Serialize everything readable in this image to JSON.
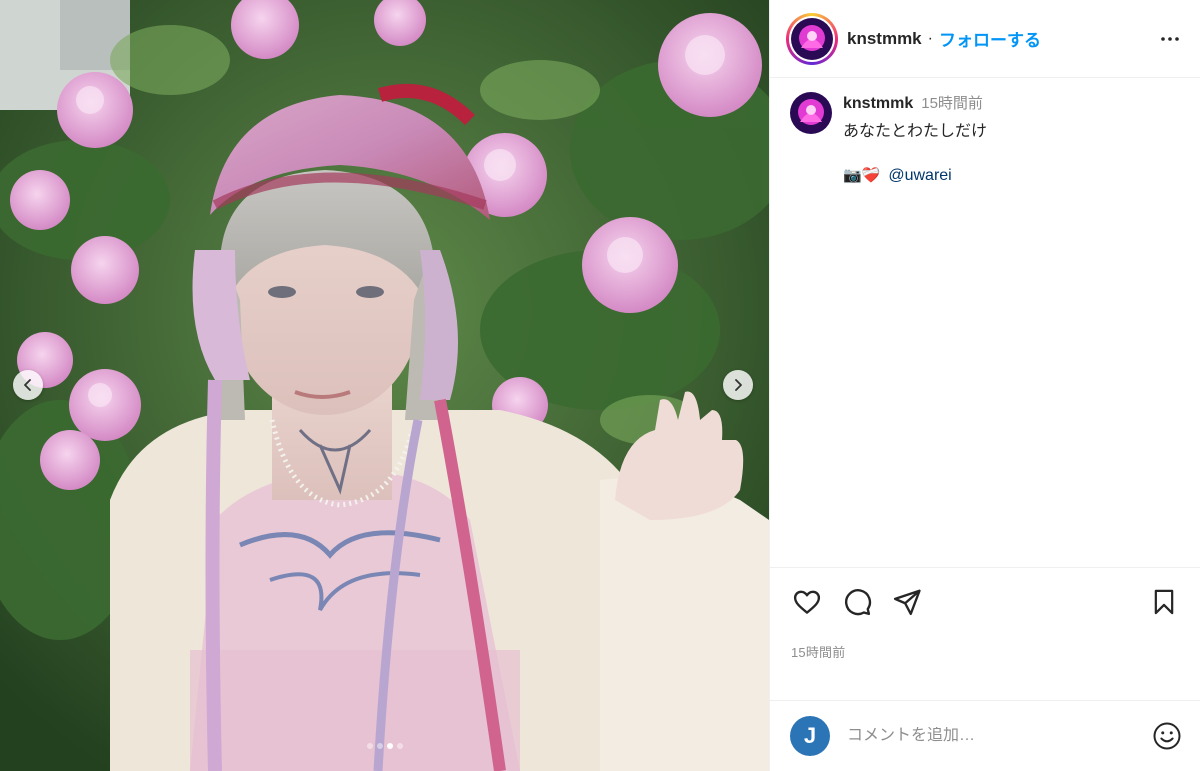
{
  "header": {
    "username": "knstmmk",
    "separator": "·",
    "follow_label": "フォローする",
    "more_icon": "more-horizontal-icon"
  },
  "caption": {
    "username": "knstmmk",
    "time": "15時間前",
    "text": "あなたとわたしだけ",
    "credit_emoji": "📷❤️‍🩹",
    "mention": "@uwarei"
  },
  "actions": {
    "like_icon": "heart-icon",
    "comment_icon": "comment-icon",
    "share_icon": "send-icon",
    "save_icon": "bookmark-icon",
    "timestamp": "15時間前"
  },
  "comment": {
    "avatar_letter": "J",
    "placeholder": "コメントを追加…",
    "emoji_icon": "smiley-icon"
  },
  "carousel": {
    "prev_icon": "chevron-left-icon",
    "next_icon": "chevron-right-icon",
    "slide_count": 4,
    "active_index": 2
  },
  "colors": {
    "follow_blue": "#0095f6",
    "mention_blue": "#00376b",
    "muted_gray": "#8e8e8e",
    "text_dark": "#262626",
    "commenter_avatar": "#2b75b6"
  }
}
